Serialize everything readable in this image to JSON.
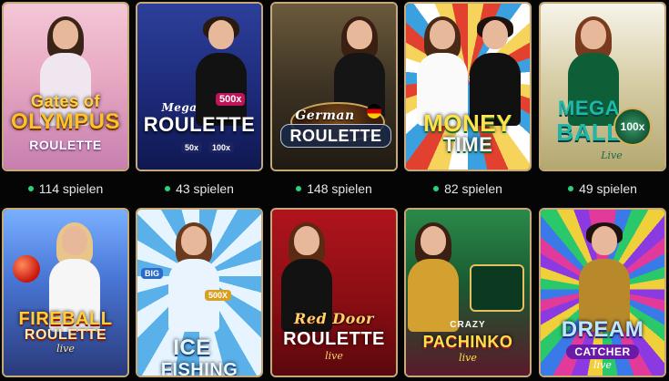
{
  "colors": {
    "card_border": "#c7a979",
    "live_dot": "#2fd07a",
    "count_text": "#e6e6e6",
    "page_bg": "#050506"
  },
  "row1": [
    {
      "title_line1": "Gates of",
      "title_line2": "OLYMPUS",
      "subtitle": "ROULETTE",
      "players": "114 spielen"
    },
    {
      "title_line1": "Mega",
      "title_line2": "ROULETTE",
      "badge1": "500x",
      "badge2": "100x",
      "badge3": "50x",
      "players": "43 spielen"
    },
    {
      "title_line1": "German",
      "title_line2": "ROULETTE",
      "players": "148 spielen"
    },
    {
      "title_line1": "MONEY",
      "title_line2": "TIME",
      "players": "82 spielen"
    },
    {
      "title_line1": "MEGA",
      "title_line2": "BALL",
      "badge1": "100x",
      "subtitle": "Live",
      "players": "49 spielen"
    }
  ],
  "row2": [
    {
      "title_line1": "FIREBALL",
      "title_line2": "ROULETTE",
      "subtitle": "live"
    },
    {
      "title_line1": "ICE",
      "title_line2": "FISHING",
      "badge1": "BIG",
      "badge2": "500X"
    },
    {
      "title_line1": "Red Door",
      "title_line2": "ROULETTE",
      "subtitle": "live"
    },
    {
      "title_line1": "CRAZY",
      "title_line2": "PACHINKO",
      "subtitle": "live"
    },
    {
      "title_line1": "DREAM",
      "title_line2": "CATCHER",
      "subtitle": "live"
    }
  ]
}
